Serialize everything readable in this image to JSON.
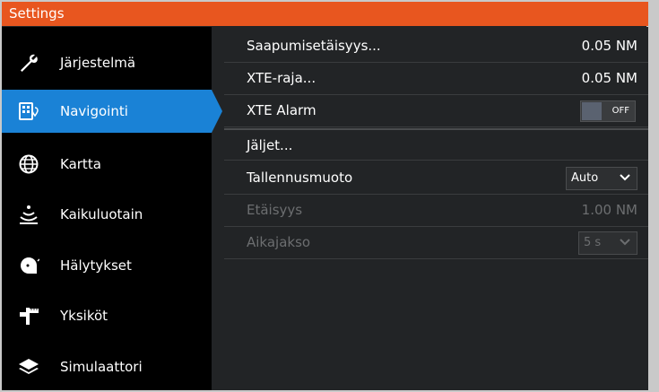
{
  "window": {
    "title": "Settings"
  },
  "sidebar": {
    "items": [
      {
        "label": "Järjestelmä",
        "icon": "wrench-icon",
        "active": false
      },
      {
        "label": "Navigointi",
        "icon": "navigation-icon",
        "active": true
      },
      {
        "label": "Kartta",
        "icon": "globe-icon",
        "active": false
      },
      {
        "label": "Kaikuluotain",
        "icon": "sonar-icon",
        "active": false
      },
      {
        "label": "Hälytykset",
        "icon": "alarm-icon",
        "active": false
      },
      {
        "label": "Yksiköt",
        "icon": "units-icon",
        "active": false
      },
      {
        "label": "Simulaattori",
        "icon": "layers-icon",
        "active": false
      }
    ]
  },
  "settings": {
    "arrival_radius": {
      "label": "Saapumisetäisyys...",
      "value": "0.05 NM"
    },
    "xte_limit": {
      "label": "XTE-raja...",
      "value": "0.05 NM"
    },
    "xte_alarm": {
      "label": "XTE Alarm",
      "toggle_text": "OFF",
      "enabled": false
    },
    "trails": {
      "label": "Jäljet..."
    },
    "logging_type": {
      "label": "Tallennusmuoto",
      "selected": "Auto"
    },
    "distance": {
      "label": "Etäisyys",
      "value": "1.00 NM",
      "disabled": true
    },
    "period": {
      "label": "Aikajakso",
      "selected": "5 s",
      "disabled": true
    }
  },
  "colors": {
    "accent": "#1a82d6",
    "titlebar": "#e8561f"
  }
}
